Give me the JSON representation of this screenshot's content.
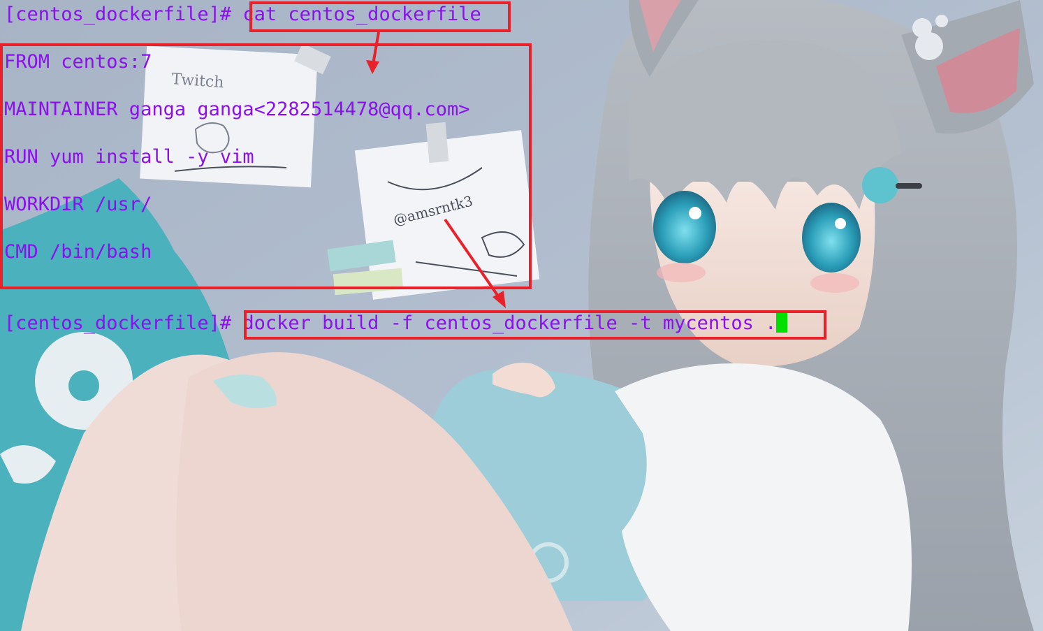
{
  "terminal": {
    "prompt": "[centos_dockerfile]#",
    "first_command": "cat centos_dockerfile",
    "file_lines": [
      "FROM centos:7",
      "MAINTAINER ganga ganga<2282514478@qq.com>",
      "RUN yum install -y vim",
      "WORKDIR /usr/",
      "CMD /bin/bash"
    ],
    "second_command": "docker build -f centos_dockerfile -t mycentos ."
  },
  "colors": {
    "text": "#8a10f0",
    "highlight_box": "#e8212a",
    "cursor": "#00e000"
  },
  "wallpaper": {
    "note1_text": "Twitch",
    "note2_text": "@amsrntk3"
  }
}
